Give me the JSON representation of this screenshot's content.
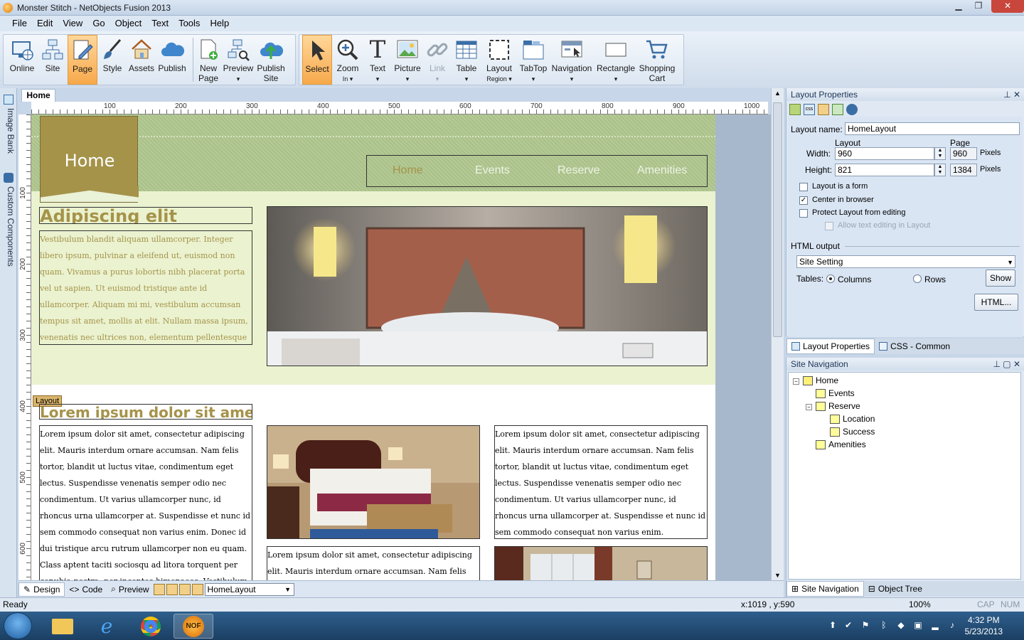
{
  "window": {
    "title": "Monster Stitch - NetObjects Fusion 2013"
  },
  "menu": [
    "File",
    "Edit",
    "View",
    "Go",
    "Object",
    "Text",
    "Tools",
    "Help"
  ],
  "toolbar": {
    "views": [
      {
        "label": "Online",
        "sub": ""
      },
      {
        "label": "Site",
        "sub": ""
      },
      {
        "label": "Page",
        "sub": ""
      },
      {
        "label": "Style",
        "sub": ""
      },
      {
        "label": "Assets",
        "sub": ""
      },
      {
        "label": "Publish",
        "sub": ""
      },
      {
        "label": "New",
        "sub": "Page"
      },
      {
        "label": "Preview",
        "sub": "▾"
      },
      {
        "label": "Publish",
        "sub": "Site"
      }
    ],
    "tools": [
      {
        "label": "Select",
        "sub": ""
      },
      {
        "label": "Zoom",
        "sub": "In ▾"
      },
      {
        "label": "Text",
        "sub": "▾"
      },
      {
        "label": "Picture",
        "sub": "▾"
      },
      {
        "label": "Link",
        "sub": "▾"
      },
      {
        "label": "Table",
        "sub": "▾"
      },
      {
        "label": "Layout",
        "sub": "Region ▾"
      },
      {
        "label": "TabTop",
        "sub": "▾"
      },
      {
        "label": "Navigation",
        "sub": "▾"
      },
      {
        "label": "Rectangle",
        "sub": "▾"
      },
      {
        "label": "Shopping",
        "sub": "Cart"
      }
    ]
  },
  "left_tabs": {
    "image_bank": "Image Bank",
    "custom_components": "Custom Components"
  },
  "document": {
    "tab": "Home",
    "ruler_h": [
      "100",
      "200",
      "300",
      "400",
      "500",
      "600",
      "700",
      "800",
      "900",
      "1000"
    ],
    "ruler_v": [
      "100",
      "200",
      "300",
      "400",
      "500",
      "600"
    ],
    "page": {
      "flag_label": "Home",
      "nav": [
        "Home",
        "Events",
        "Reserve",
        "Amenities"
      ],
      "heading1": "Adipiscing elit",
      "para1": "Vestibulum blandit aliquam ullamcorper. Integer libero ipsum, pulvinar a eleifend ut, euismod non quam. Vivamus a purus lobortis nibh placerat porta vel ut sapien. Ut euismod tristique ante id ullamcorper. Aliquam mi mi, vestibulum accumsan tempus sit amet, mollis at elit. Nullam massa ipsum, venenatis nec ultrices non, elementum pellentesque leo.",
      "layout_tag": "Layout",
      "heading2": "Lorem ipsum dolor sit amet",
      "para2": "Lorem ipsum dolor sit amet, consectetur adipiscing elit. Mauris interdum ornare accumsan. Nam felis tortor, blandit ut luctus vitae, condimentum eget lectus. Suspendisse venenatis semper odio nec condimentum. Ut varius ullamcorper nunc, id rhoncus urna ullamcorper at. Suspendisse et nunc id sem commodo consequat non varius enim. Donec id dui tristique arcu rutrum ullamcorper non eu quam. Class aptent taciti sociosqu ad litora torquent per conubia nostra, per inceptos himenaeos. Vestibulum euismod",
      "para3": "Lorem ipsum dolor sit amet, consectetur adipiscing elit. Mauris interdum ornare accumsan. Nam felis tortor, blandit ut luctus vitae, condimentum eget lectus. Suspendisse venenatis semper odio nec condimentum. Ut varius ullamcorper nunc, id rhoncus urna ullamcorper at. Suspendisse et nunc id sem commodo consequat non varius enim.",
      "para4": "Lorem ipsum dolor sit amet, consectetur adipiscing elit. Mauris interdum ornare accumsan. Nam felis"
    }
  },
  "bottom_bar": {
    "design": "Design",
    "code": "Code",
    "preview": "Preview",
    "layout_select": "HomeLayout"
  },
  "layout_properties": {
    "title": "Layout Properties",
    "layout_name_label": "Layout name:",
    "layout_name": "HomeLayout",
    "col_layout": "Layout",
    "col_page": "Page",
    "width_label": "Width:",
    "width": "960",
    "page_width": "960",
    "height_label": "Height:",
    "height": "821",
    "page_height": "1384",
    "unit": "Pixels",
    "chk_form": "Layout is a form",
    "chk_center": "Center in browser",
    "chk_protect": "Protect Layout from editing",
    "chk_allow": "Allow text editing in Layout",
    "html_output_label": "HTML output",
    "html_output": "Site Setting",
    "tables_label": "Tables:",
    "radio_columns": "Columns",
    "radio_rows": "Rows",
    "show_btn": "Show",
    "html_btn": "HTML...",
    "tab_layout": "Layout Properties",
    "tab_css": "CSS - Common"
  },
  "site_navigation": {
    "title": "Site Navigation",
    "tree": [
      "Home",
      "Events",
      "Reserve",
      "Location",
      "Success",
      "Amenities"
    ],
    "tab_nav": "Site Navigation",
    "tab_tree": "Object Tree"
  },
  "status": {
    "left": "Ready",
    "coords": "x:1019 , y:590",
    "zoom": "100%",
    "cap": "CAP",
    "num": "NUM"
  },
  "taskbar": {
    "time": "4:32 PM",
    "date": "5/23/2013",
    "nof": "NOF"
  }
}
